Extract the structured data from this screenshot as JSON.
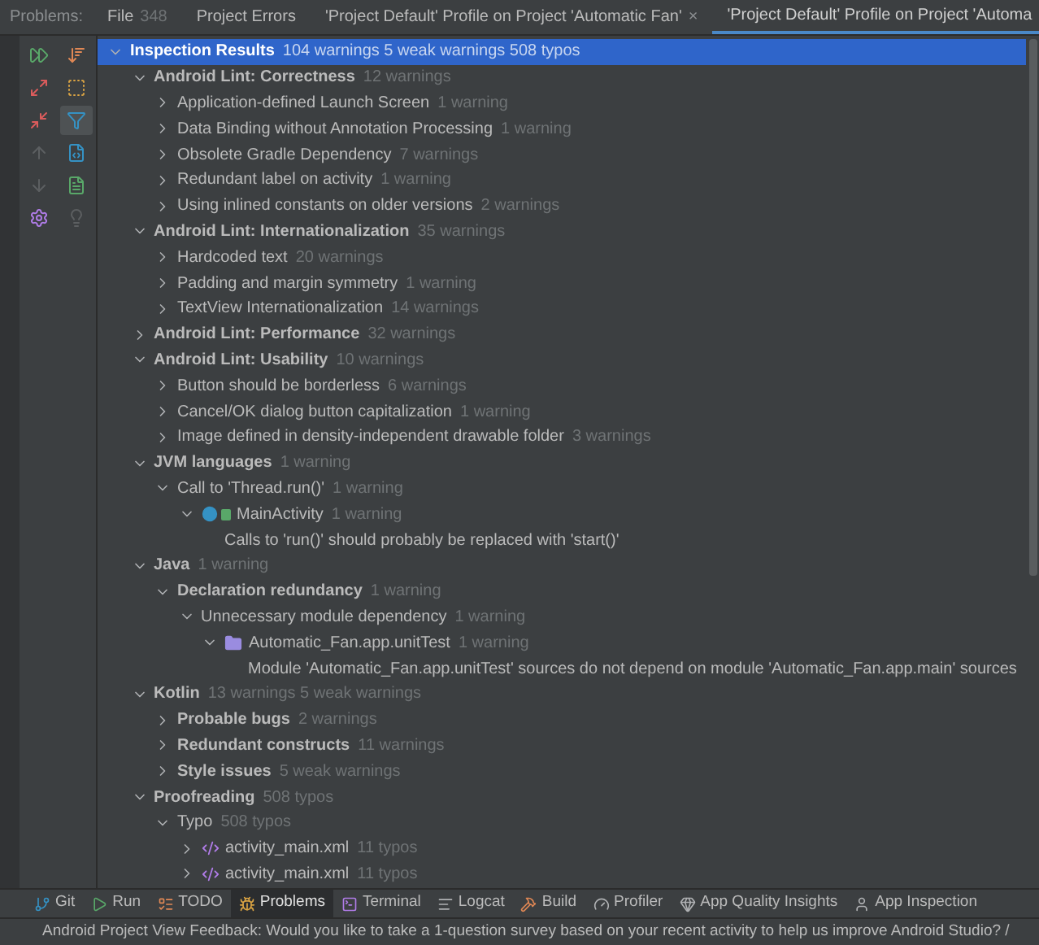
{
  "tabs_label": "Problems:",
  "tabs": [
    {
      "label": "File",
      "count": "348",
      "selected": false
    },
    {
      "label": "Project Errors",
      "selected": false
    },
    {
      "label": "'Project Default' Profile on Project 'Automatic Fan'",
      "close": "×",
      "selected": false
    },
    {
      "label": "'Project Default' Profile on Project 'Automa",
      "selected": true
    }
  ],
  "toolbar": [
    {
      "kind": "rerun",
      "selected": false,
      "disabled": false
    },
    {
      "kind": "sort",
      "selected": false,
      "disabled": false
    },
    {
      "kind": "expand",
      "selected": false,
      "disabled": false
    },
    {
      "kind": "module",
      "selected": false,
      "disabled": false
    },
    {
      "kind": "collapse",
      "selected": false,
      "disabled": false
    },
    {
      "kind": "filter",
      "selected": true,
      "disabled": false
    },
    {
      "kind": "up",
      "selected": false,
      "disabled": true
    },
    {
      "kind": "code",
      "selected": false,
      "disabled": false
    },
    {
      "kind": "down",
      "selected": false,
      "disabled": true
    },
    {
      "kind": "file",
      "selected": false,
      "disabled": false
    },
    {
      "kind": "settings",
      "selected": false,
      "disabled": false
    },
    {
      "kind": "bulb",
      "selected": false,
      "disabled": true
    }
  ],
  "tree": [
    {
      "kind": "category",
      "label": "Inspection Results",
      "count": "104 warnings 5 weak warnings 508 typos",
      "selected": true,
      "expanded": true,
      "children": [
        {
          "kind": "category",
          "label": "Android Lint: Correctness",
          "count": "12 warnings",
          "selected": false,
          "expanded": true,
          "children": [
            {
              "kind": "inspection",
              "label": "Application-defined Launch Screen",
              "count": "1 warning",
              "selected": false,
              "expanded": false
            },
            {
              "kind": "inspection",
              "label": "Data Binding without Annotation Processing",
              "count": "1 warning",
              "selected": false,
              "expanded": false
            },
            {
              "kind": "inspection",
              "label": "Obsolete Gradle Dependency",
              "count": "7 warnings",
              "selected": false,
              "expanded": false
            },
            {
              "kind": "inspection",
              "label": "Redundant label on activity",
              "count": "1 warning",
              "selected": false,
              "expanded": false
            },
            {
              "kind": "inspection",
              "label": "Using inlined constants on older versions",
              "count": "2 warnings",
              "selected": false,
              "expanded": false
            }
          ]
        },
        {
          "kind": "category",
          "label": "Android Lint: Internationalization",
          "count": "35 warnings",
          "selected": false,
          "expanded": true,
          "children": [
            {
              "kind": "inspection",
              "label": "Hardcoded text",
              "count": "20 warnings",
              "selected": false,
              "expanded": false
            },
            {
              "kind": "inspection",
              "label": "Padding and margin symmetry",
              "count": "1 warning",
              "selected": false,
              "expanded": false
            },
            {
              "kind": "inspection",
              "label": "TextView Internationalization",
              "count": "14 warnings",
              "selected": false,
              "expanded": false
            }
          ]
        },
        {
          "kind": "category",
          "label": "Android Lint: Performance",
          "count": "32 warnings",
          "selected": false,
          "expanded": false
        },
        {
          "kind": "category",
          "label": "Android Lint: Usability",
          "count": "10 warnings",
          "selected": false,
          "expanded": true,
          "children": [
            {
              "kind": "inspection",
              "label": "Button should be borderless",
              "count": "6 warnings",
              "selected": false,
              "expanded": false
            },
            {
              "kind": "inspection",
              "label": "Cancel/OK dialog button capitalization",
              "count": "1 warning",
              "selected": false,
              "expanded": false
            },
            {
              "kind": "inspection",
              "label": "Image defined in density-independent drawable folder",
              "count": "3 warnings",
              "selected": false,
              "expanded": false
            }
          ]
        },
        {
          "kind": "category",
          "label": "JVM languages",
          "count": "1 warning",
          "selected": false,
          "expanded": true,
          "children": [
            {
              "kind": "inspection",
              "label": "Call to 'Thread.run()'",
              "count": "1 warning",
              "selected": false,
              "expanded": true,
              "children": [
                {
                  "kind": "class",
                  "label": "MainActivity",
                  "count": "1 warning",
                  "selected": false,
                  "expanded": true,
                  "children": [
                    {
                      "kind": "message",
                      "label": "Calls to 'run()' should probably be replaced with 'start()'",
                      "selected": false
                    }
                  ]
                }
              ]
            }
          ]
        },
        {
          "kind": "category",
          "label": "Java",
          "count": "1 warning",
          "selected": false,
          "expanded": true,
          "children": [
            {
              "kind": "category",
              "label": "Declaration redundancy",
              "count": "1 warning",
              "selected": false,
              "expanded": true,
              "children": [
                {
                  "kind": "inspection",
                  "label": "Unnecessary module dependency",
                  "count": "1 warning",
                  "selected": false,
                  "expanded": true,
                  "children": [
                    {
                      "kind": "module",
                      "label": "Automatic_Fan.app.unitTest",
                      "count": "1 warning",
                      "selected": false,
                      "expanded": true,
                      "children": [
                        {
                          "kind": "message",
                          "label": "Module 'Automatic_Fan.app.unitTest' sources do not depend on module 'Automatic_Fan.app.main' sources",
                          "selected": false
                        }
                      ]
                    }
                  ]
                }
              ]
            }
          ]
        },
        {
          "kind": "category",
          "label": "Kotlin",
          "count": "13 warnings 5 weak warnings",
          "selected": false,
          "expanded": true,
          "children": [
            {
              "kind": "category",
              "label": "Probable bugs",
              "count": "2 warnings",
              "selected": false,
              "expanded": false
            },
            {
              "kind": "category",
              "label": "Redundant constructs",
              "count": "11 warnings",
              "selected": false,
              "expanded": false
            },
            {
              "kind": "category",
              "label": "Style issues",
              "count": "5 weak warnings",
              "selected": false,
              "expanded": false
            }
          ]
        },
        {
          "kind": "category",
          "label": "Proofreading",
          "count": "508 typos",
          "selected": false,
          "expanded": true,
          "children": [
            {
              "kind": "inspection",
              "label": "Typo",
              "count": "508 typos",
              "selected": false,
              "expanded": true,
              "children": [
                {
                  "kind": "xml",
                  "label": "activity_main.xml",
                  "count": "11 typos",
                  "selected": false,
                  "expanded": false
                },
                {
                  "kind": "xml",
                  "label": "activity_main.xml",
                  "count": "11 typos",
                  "selected": false,
                  "expanded": false
                }
              ]
            }
          ]
        }
      ]
    }
  ],
  "bottom_tools": [
    {
      "kind": "git",
      "label": "Git",
      "selected": false
    },
    {
      "kind": "run",
      "label": "Run",
      "selected": false
    },
    {
      "kind": "todo",
      "label": "TODO",
      "selected": false
    },
    {
      "kind": "problems",
      "label": "Problems",
      "selected": true
    },
    {
      "kind": "terminal",
      "label": "Terminal",
      "selected": false
    },
    {
      "kind": "logcat",
      "label": "Logcat",
      "selected": false
    },
    {
      "kind": "build",
      "label": "Build",
      "selected": false
    },
    {
      "kind": "profiler",
      "label": "Profiler",
      "selected": false
    },
    {
      "kind": "quality",
      "label": "App Quality Insights",
      "selected": false
    },
    {
      "kind": "inspection",
      "label": "App Inspection",
      "selected": false
    }
  ],
  "status_bar": "Android Project View Feedback: Would you like to take a 1-question survey based on your recent activity to help us improve Android Studio? /"
}
